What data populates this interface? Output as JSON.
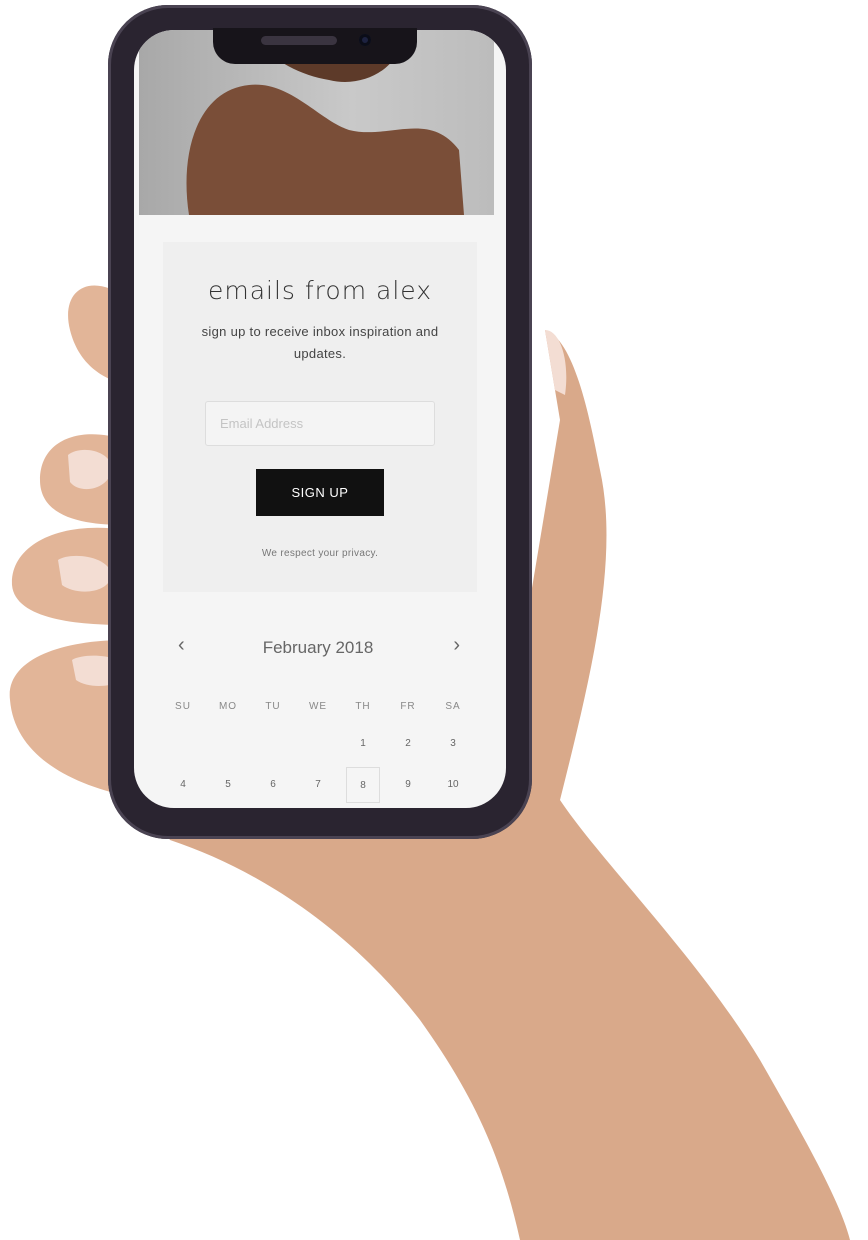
{
  "signup": {
    "title": "emails from alex",
    "subtitle": "sign up to receive inbox inspiration and updates.",
    "email_placeholder": "Email Address",
    "email_value": "",
    "button_label": "SIGN UP",
    "privacy_text": "We respect your privacy."
  },
  "calendar": {
    "month_label": "February 2018",
    "prev_icon": "chevron-left-icon",
    "next_icon": "chevron-right-icon",
    "weekdays": [
      "SU",
      "MO",
      "TU",
      "WE",
      "TH",
      "FR",
      "SA"
    ],
    "days": [
      "",
      "",
      "",
      "",
      "1",
      "2",
      "3",
      "4",
      "5",
      "6",
      "7",
      "8",
      "9",
      "10"
    ],
    "selected_day": "8"
  },
  "colors": {
    "button": "#111111",
    "screen_bg": "#f5f5f5",
    "card_bg": "#efefef"
  }
}
